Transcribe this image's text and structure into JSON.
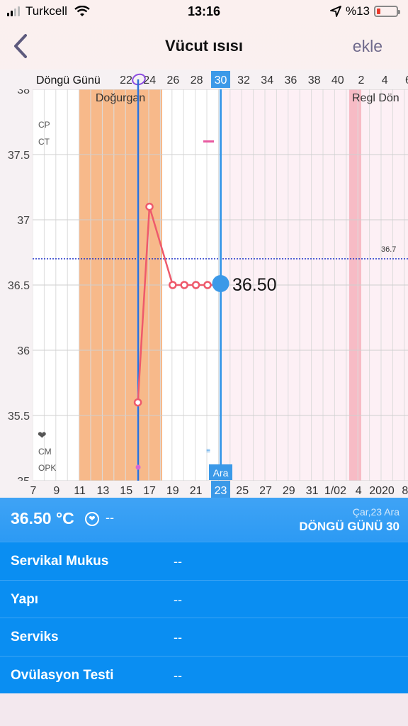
{
  "status_bar": {
    "carrier": "Turkcell",
    "time": "13:16",
    "battery": "%13"
  },
  "nav": {
    "title": "Vücut ısısı",
    "add_label": "ekle"
  },
  "chart": {
    "header_label": "Döngü Günü",
    "cycle_day_ticks": [
      "22",
      "24",
      "26",
      "28",
      "30",
      "32",
      "34",
      "36",
      "38",
      "40",
      "2",
      "4",
      "6"
    ],
    "selected_cycle_day": "30",
    "fertile_label": "Doğurgan",
    "period_label": "Regl Dön",
    "y_ticks": [
      "38",
      "37.5",
      "37",
      "36.5",
      "36",
      "35.5",
      "35"
    ],
    "side_labels": {
      "cp": "CP",
      "ct": "CT",
      "cm": "CM",
      "opk": "OPK"
    },
    "threshold_label": "36.7",
    "current_value_label": "36.50",
    "date_ticks": [
      "7",
      "9",
      "11",
      "13",
      "15",
      "17",
      "19",
      "21",
      "23",
      "25",
      "27",
      "29",
      "31",
      "1/02",
      "4",
      "2020",
      "8"
    ],
    "selected_date": "23",
    "selected_month": "Ara",
    "year_label": "2020"
  },
  "chart_data": {
    "type": "line",
    "x": [
      "16 Ara",
      "17 Ara",
      "19 Ara",
      "20 Ara",
      "21 Ara",
      "22 Ara",
      "23 Ara"
    ],
    "series": [
      {
        "values": [
          35.6,
          37.1,
          36.5,
          36.5,
          36.5,
          36.5,
          36.5
        ]
      }
    ],
    "ylim": [
      35,
      38
    ],
    "coverline": 36.7,
    "grid": true
  },
  "panel": {
    "temperature": "36.50 °C",
    "temp_extra": "--",
    "date": "Çar,23 Ara",
    "cycle_day": "DÖNGÜ GÜNÜ 30",
    "rows": [
      {
        "label": "Servikal Mukus",
        "value": "--"
      },
      {
        "label": "Yapı",
        "value": "--"
      },
      {
        "label": "Serviks",
        "value": "--"
      },
      {
        "label": "Ovülasyon Testi",
        "value": "--"
      }
    ]
  },
  "colors": {
    "accent": "#0a8ef2",
    "selected_line": "#3b99e8",
    "fertile": "#f7b98a",
    "period": "#f6b5c0",
    "data_line": "#ee5a6c",
    "coverline": "#1a2fc9"
  },
  "icons": {
    "back": "chevron-left-icon",
    "wifi": "wifi-icon",
    "location": "location-arrow-icon",
    "heart": "heart-icon"
  }
}
